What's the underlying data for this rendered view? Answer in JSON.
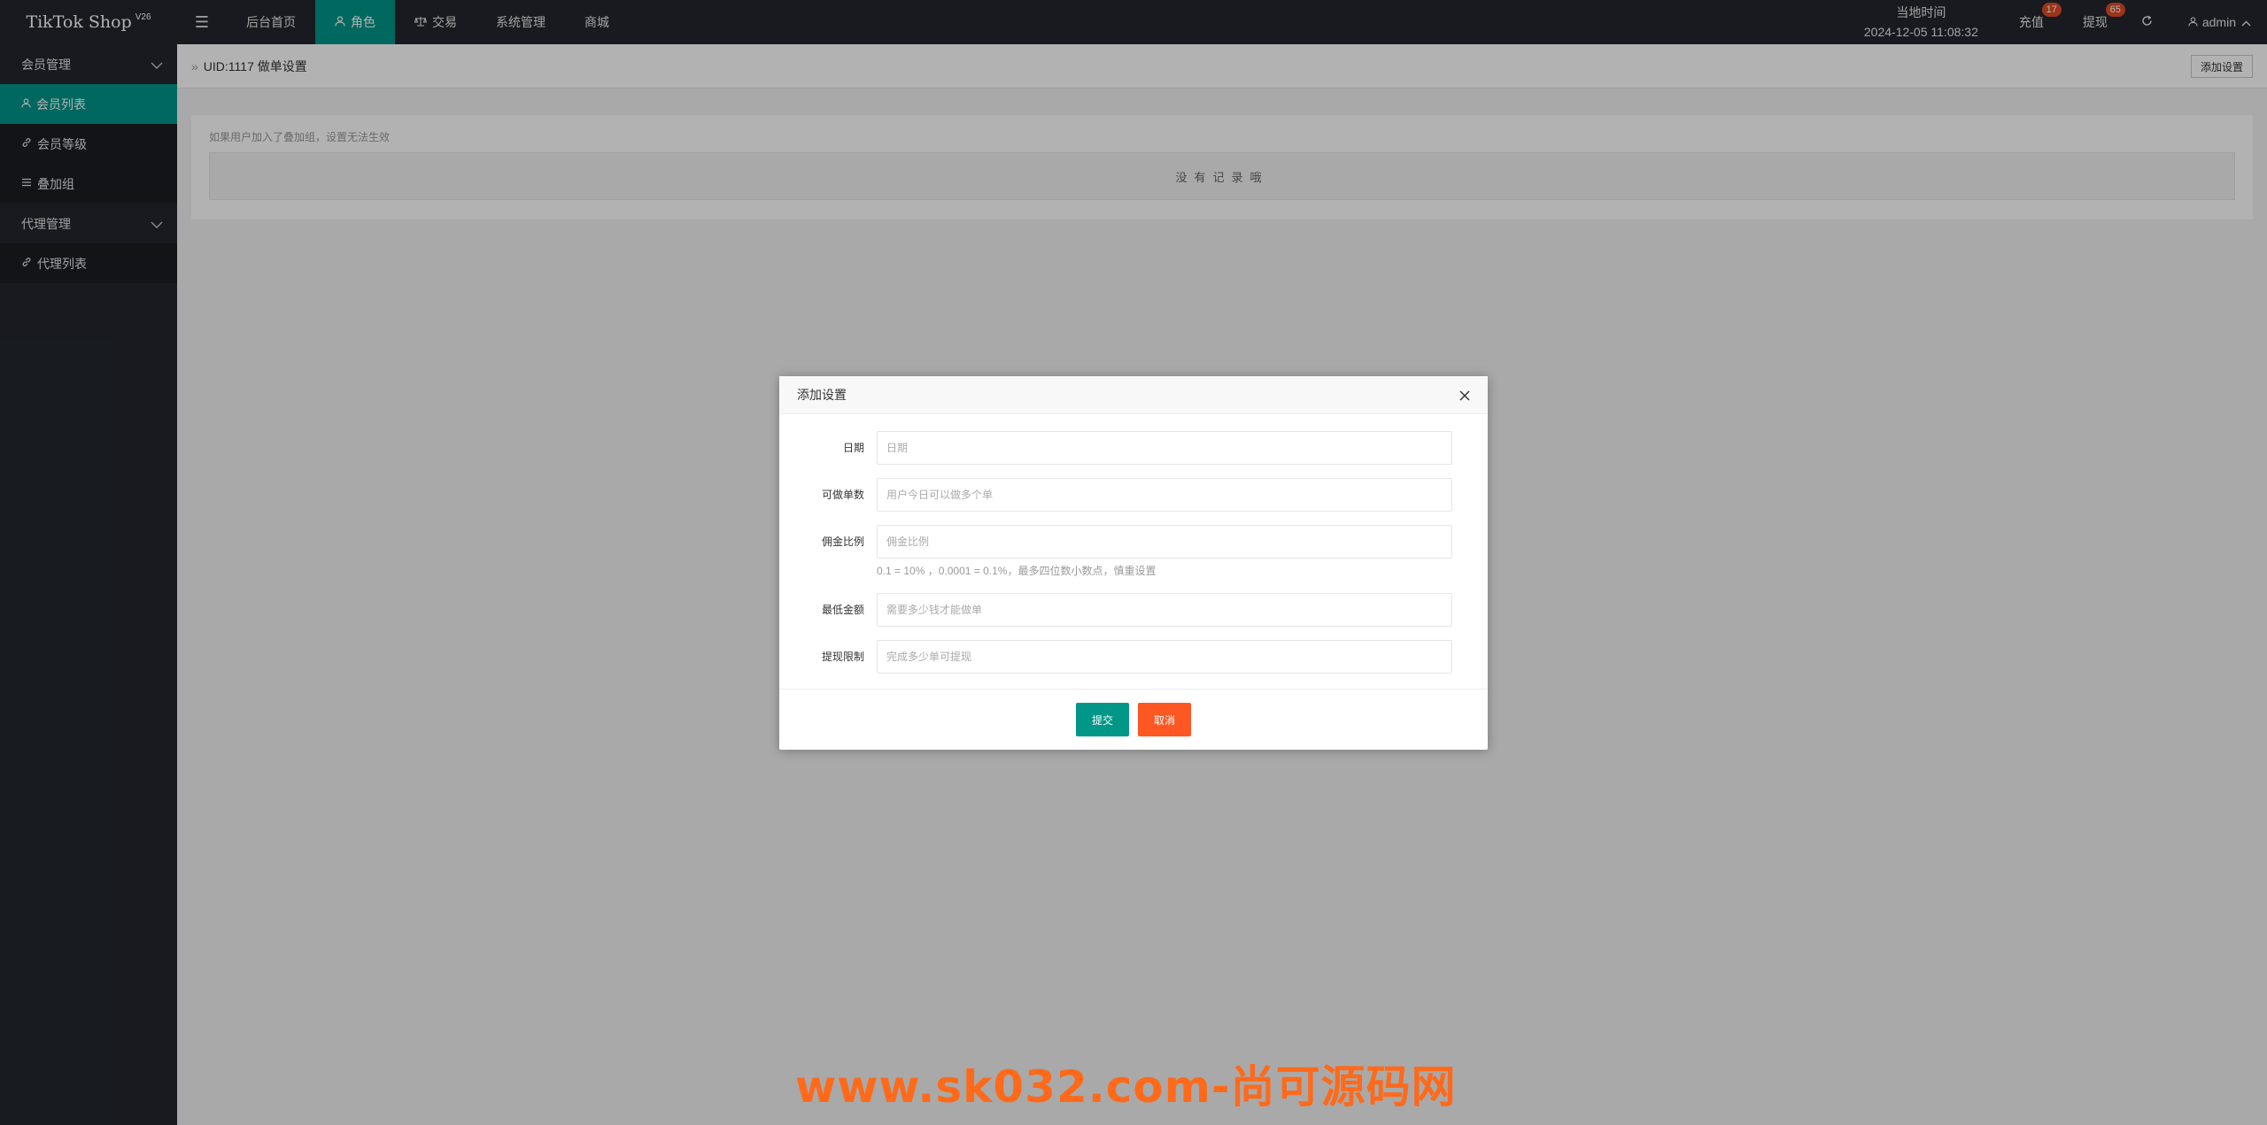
{
  "header": {
    "logo": "TikTok Shop",
    "logo_version": "V26",
    "nav": [
      {
        "label": "后台首页",
        "icon": "home"
      },
      {
        "label": "角色",
        "icon": "user-icon"
      },
      {
        "label": "交易",
        "icon": "scale-icon"
      },
      {
        "label": "系统管理"
      },
      {
        "label": "商城"
      }
    ],
    "time_label": "当地时间",
    "time_value": "2024-12-05 11:08:32",
    "recharge_label": "充值",
    "recharge_count": "17",
    "withdraw_label": "提现",
    "withdraw_count": "65",
    "user": "admin"
  },
  "sidebar": {
    "groups": [
      {
        "label": "会员管理",
        "items": [
          {
            "label": "会员列表",
            "icon": "user-icon"
          },
          {
            "label": "会员等级",
            "icon": "link-icon"
          },
          {
            "label": "叠加组",
            "icon": "list-icon"
          }
        ]
      },
      {
        "label": "代理管理",
        "items": [
          {
            "label": "代理列表",
            "icon": "link-icon"
          }
        ]
      }
    ]
  },
  "main": {
    "breadcrumb": "UID:1117 做单设置",
    "add_button": "添加设置",
    "tip": "如果用户加入了叠加组，设置无法生效",
    "empty_text": "没有记录哦"
  },
  "modal": {
    "title": "添加设置",
    "fields": [
      {
        "label": "日期",
        "placeholder": "日期"
      },
      {
        "label": "可做单数",
        "placeholder": "用户今日可以做多个单"
      },
      {
        "label": "佣金比例",
        "placeholder": "佣金比例",
        "hint": "0.1 = 10% ，0.0001 = 0.1%，最多四位数小数点，慎重设置"
      },
      {
        "label": "最低金额",
        "placeholder": "需要多少钱才能做单"
      },
      {
        "label": "提现限制",
        "placeholder": "完成多少单可提现"
      }
    ],
    "submit": "提交",
    "cancel": "取消"
  },
  "watermark": "www.sk032.com-尚可源码网",
  "colors": {
    "primary": "#009688",
    "danger": "#ff5722",
    "dark": "#23262e",
    "badge": "#e04b24"
  }
}
